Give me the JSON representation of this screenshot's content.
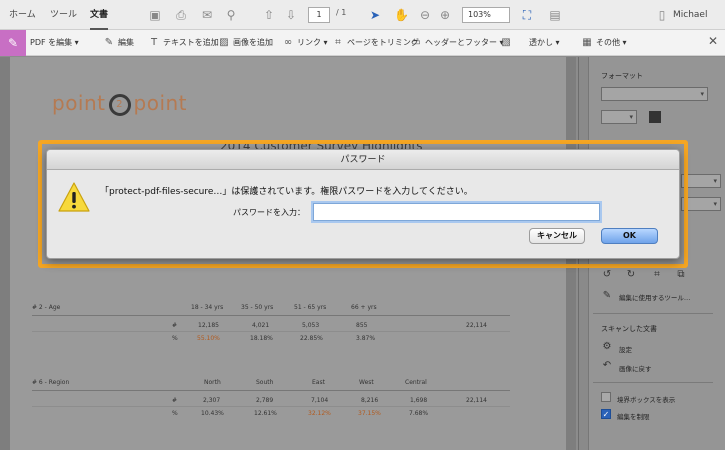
{
  "topbar": {
    "tabs": [
      "ホーム",
      "ツール",
      "文書"
    ],
    "page_current": "1",
    "page_total": "/ 1",
    "zoom": "103%",
    "user": "Michael"
  },
  "toolbar": {
    "pdf_edit": "PDF を編集",
    "edit": "編集",
    "add_text": "テキストを追加",
    "add_image": "画像を追加",
    "link": "リンク",
    "crop_pages": "ページをトリミング",
    "header_footer": "ヘッダーとフッター",
    "watermark": "透かし",
    "more": "その他"
  },
  "document": {
    "logo_left": "point",
    "logo_num": "2",
    "logo_right": "point",
    "title": "2014 Customer Survey Highlights",
    "section_age": {
      "label": "# 2 - Age",
      "columns": [
        "18 - 34 yrs",
        "35 - 50 yrs",
        "51 - 65 yrs",
        "66 + yrs"
      ],
      "count_label": "#",
      "counts": [
        "12,185",
        "4,021",
        "5,053",
        "855"
      ],
      "count_total": "22,114",
      "pct_label": "%",
      "pcts": [
        "55.10%",
        "18.18%",
        "22.85%",
        "3.87%"
      ]
    },
    "section_region": {
      "label": "# 6 - Region",
      "columns": [
        "North",
        "South",
        "East",
        "West",
        "Central"
      ],
      "count_label": "#",
      "counts": [
        "2,307",
        "2,789",
        "7,104",
        "8,216",
        "1,698"
      ],
      "count_total": "22,114",
      "pct_label": "%",
      "pcts": [
        "10.43%",
        "12.61%",
        "32.12%",
        "37.15%",
        "7.68%"
      ]
    }
  },
  "right_panel": {
    "format_heading": "フォーマット",
    "edit_tool_label": "編集に使用するツール…",
    "scanned_heading": "スキャンした文書",
    "settings": "設定",
    "revert": "画像に戻す",
    "show_bbox": "境界ボックスを表示",
    "restrict_edit": "編集を制限"
  },
  "dialog": {
    "title": "パスワード",
    "message": "「protect-pdf-files-secure…」は保護されています。権限パスワードを入力してください。",
    "field_label": "パスワードを入力：",
    "password_value": "",
    "cancel_label": "キャンセル",
    "ok_label": "OK"
  },
  "colors": {
    "highlight": "#f5a623",
    "accent": "#c86fc4",
    "ok_button": "#6fa3ea",
    "data_highlight": "#b25a1e"
  }
}
